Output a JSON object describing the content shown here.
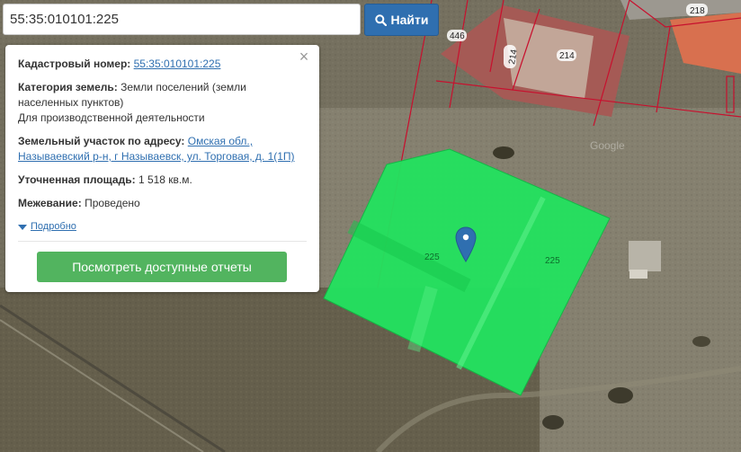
{
  "search": {
    "value": "55:35:010101:225",
    "button_label": "Найти"
  },
  "info": {
    "close_glyph": "×",
    "cadastral_label": "Кадастровый номер:",
    "cadastral_value": "55:35:010101:225",
    "category_label": "Категория земель:",
    "category_value": "Земли поселений (земли населенных пунктов)",
    "category_use": "Для производственной деятельности",
    "address_label": "Земельный участок по адресу:",
    "address_value": "Омская обл., Называевский р-н, г Называевск, ул. Торговая, д. 1(1П)",
    "area_label": "Уточненная площадь:",
    "area_value": "1 518 кв.м.",
    "survey_label": "Межевание:",
    "survey_value": "Проведено",
    "more_label": "Подробно",
    "reports_button": "Посмотреть доступные отчеты"
  },
  "map": {
    "parcel_labels": [
      "446",
      "214",
      "214",
      "218",
      "225",
      "225"
    ],
    "watermark": "Google",
    "parcel_color": "#22e35f",
    "boundary_color": "#c8102e",
    "marker_color": "#2f6fb0"
  }
}
